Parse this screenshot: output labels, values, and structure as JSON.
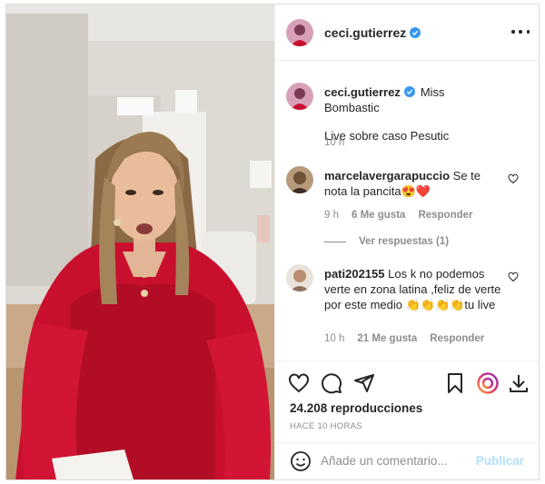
{
  "post": {
    "username": "ceci.gutierrez",
    "verified": true,
    "views": "24.208 reproducciones",
    "time_ago": "HACE 10 HORAS"
  },
  "caption": {
    "username": "ceci.gutierrez",
    "text": "Miss Bombastic",
    "text2": "Live sobre caso Pesutic",
    "time": "10 h"
  },
  "comments": [
    {
      "username": "marcelavergarapuccio",
      "text": "Se te nota la pancita😍❤️",
      "time": "9 h",
      "likes": "6 Me gusta",
      "reply": "Responder",
      "view_replies": "Ver respuestas (1)"
    },
    {
      "username": "pati202155",
      "text": "Los k no podemos verte en zona latina ,feliz de verte por este medio 👏👏👏👏tu live",
      "time": "10 h",
      "likes": "21 Me gusta",
      "reply": "Responder"
    }
  ],
  "add_comment": {
    "placeholder": "Añade un comentario...",
    "post_label": "Publicar"
  },
  "icons": [
    "verified-icon",
    "more-options-icon",
    "heart-icon",
    "comment-icon",
    "share-icon",
    "save-icon",
    "emoji-icon",
    "download-icon",
    "reels-icon"
  ],
  "colors": {
    "verified": "#3897f0",
    "link": "#b2dffc",
    "secondary": "#8e8e8e",
    "dress": "#c8102e"
  }
}
